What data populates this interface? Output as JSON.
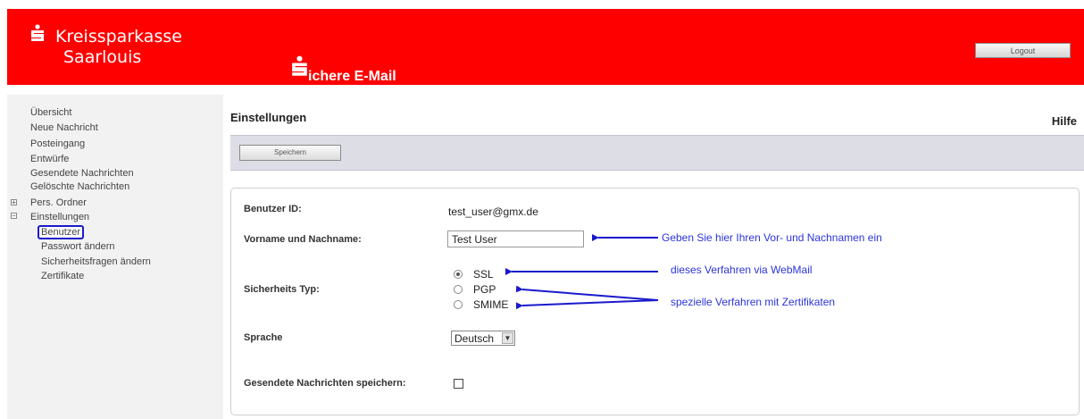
{
  "header": {
    "bank_name_line1": "Kreissparkasse",
    "bank_name_line2": "Saarlouis",
    "app_title": "ichere E-Mail",
    "logout_label": "Logout",
    "brand_color": "#ff0000"
  },
  "sidebar": {
    "items": [
      {
        "label": "Übersicht"
      },
      {
        "label": "Neue Nachricht"
      },
      {
        "label": "Posteingang"
      },
      {
        "label": "Entwürfe"
      },
      {
        "label": "Gesendete Nachrichten"
      },
      {
        "label": "Gelöschte Nachrichten"
      },
      {
        "label": "Pers. Ordner",
        "expander": "⊞"
      },
      {
        "label": "Einstellungen",
        "expander": "⊟"
      }
    ],
    "sub_items": [
      {
        "label": "Benutzer",
        "active": true
      },
      {
        "label": "Passwort ändern"
      },
      {
        "label": "Sicherheitsfragen ändern"
      },
      {
        "label": "Zertifikate"
      }
    ]
  },
  "main": {
    "title": "Einstellungen",
    "help_label": "Hilfe",
    "save_label": "Speichern",
    "form": {
      "user_id_label": "Benutzer ID:",
      "user_id_value": "test_user@gmx.de",
      "name_label": "Vorname und Nachname:",
      "name_value": "Test User",
      "security_label": "Sicherheits Typ:",
      "security_options": [
        "SSL",
        "PGP",
        "SMIME"
      ],
      "security_selected": "SSL",
      "language_label": "Sprache",
      "language_value": "Deutsch",
      "save_sent_label": "Gesendete Nachrichten speichern:",
      "save_sent_checked": false
    },
    "annotations": {
      "name_hint": "Geben Sie hier Ihren Vor- und Nachnamen ein",
      "ssl_hint": "dieses Verfahren via WebMail",
      "cert_hint": "spezielle Verfahren mit Zertifikaten",
      "color": "#2b35d8"
    }
  }
}
